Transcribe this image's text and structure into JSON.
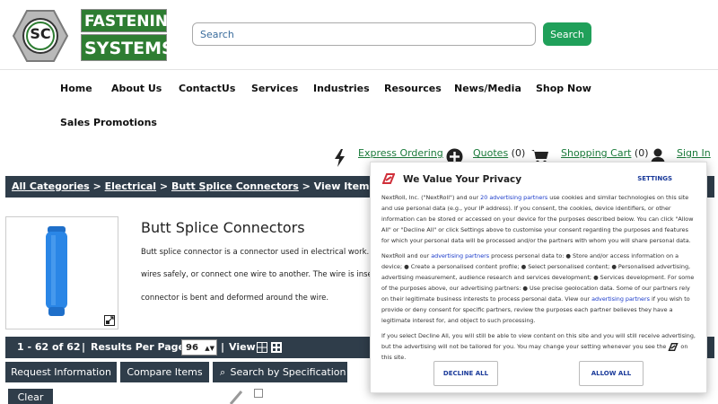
{
  "logo": {
    "line1": "FASTENING",
    "line2": "SYSTEMS",
    "mark": "SC"
  },
  "search": {
    "placeholder": "Search",
    "button": "Search"
  },
  "nav": {
    "row1": [
      "Home",
      "About Us",
      "ContactUs",
      "Services",
      "Industries",
      "Resources",
      "News/Media",
      "Shop Now"
    ],
    "row2": [
      "Sales Promotions"
    ]
  },
  "utility": {
    "express": "Express Ordering",
    "quotes": "Quotes",
    "quotes_count": "(0)",
    "cart": "Shopping Cart",
    "cart_count": "(0)",
    "signin": "Sign In"
  },
  "breadcrumb": {
    "c1": "All Categories",
    "sep": ">",
    "c2": "Electrical",
    "c3": "Butt Splice Connectors",
    "c4": "View Items"
  },
  "product": {
    "title": "Butt Splice Connectors",
    "desc1": "Butt splice connector is a connector used in electrical work. A b",
    "desc2": "wires safely, or connect one wire to another. The wire is inserte",
    "desc3": "connector is bent and deformed around the wire."
  },
  "results": {
    "range": "1 - 62 of 62",
    "per_page_label": "Results Per Page",
    "per_page_value": "96",
    "view_label": "View"
  },
  "actions": {
    "request": "Request Information",
    "compare": "Compare Items",
    "search_spec": "Search by Specification",
    "clear": "Clear"
  },
  "privacy": {
    "title": "We Value Your Privacy",
    "settings": "SETTINGS",
    "p1_a": "NextRoll, Inc. (\"NextRoll\") and our",
    "p1_link": "20 advertising partners",
    "p1_b": "use cookies and similar technologies on this site and use personal data (e.g., your IP address). If you consent, the cookies, device identifiers, or other information can be stored or accessed on your device for the purposes described below. You can click \"Allow All\" or \"Decline All\" or click Settings above to customise your consent regarding the purposes and features for which your personal data will be processed and/or the partners with whom you will share personal data.",
    "p2_a": "NextRoll and our",
    "p2_link": "advertising partners",
    "p2_b": "process personal data to: ● Store and/or access information on a device; ● Create a personalised content profile; ● Select personalised content; ● Personalised advertising, advertising measurement, audience research and services development; ● Services development. For some of the purposes above, our advertising partners: ● Use precise geolocation data. Some of our partners rely on their legitimate business interests to process personal data. View our",
    "p2_link2": "advertising partners",
    "p2_c": "if you wish to provide or deny consent for specific partners, review the purposes each partner believes they have a legitimate interest for, and object to such processing.",
    "p3_a": "If you select Decline All, you will still be able to view content on this site and you will still receive advertising, but the advertising will not be tailored for you. You may change your setting whenever you see the",
    "p3_b": "on this site.",
    "decline": "DECLINE ALL",
    "allow": "ALLOW ALL"
  },
  "colors": {
    "accent_green": "#20a05a",
    "dark_bar": "#2f3d4a",
    "link_green": "#1a7a3a",
    "modal_red": "#d0303a"
  }
}
